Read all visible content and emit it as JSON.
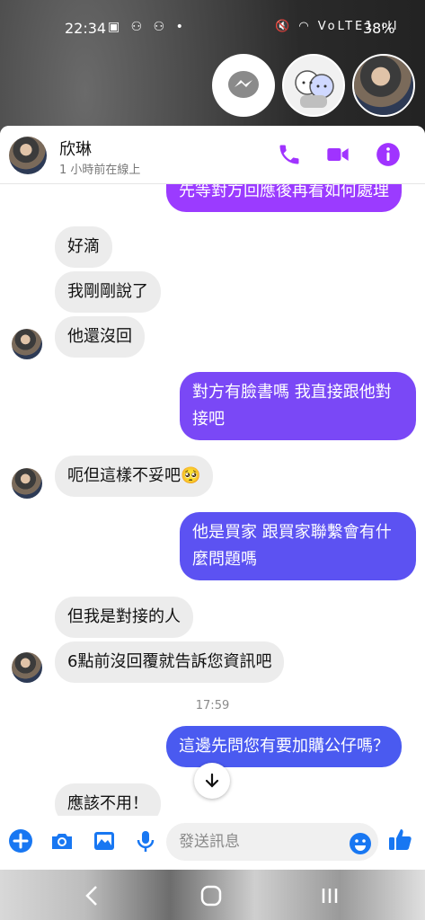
{
  "status_bar": {
    "time": "22:34",
    "left_icons": "▣ ⚇ ⚇ •",
    "right_icons": "🔇 ◠ VoLTE1 ıll",
    "battery": "38%"
  },
  "header": {
    "name": "欣琳",
    "status": "1 小時前在線上"
  },
  "messages": [
    {
      "dir": "out",
      "text": "先等對方回應後再看如何處理"
    },
    {
      "dir": "in",
      "text": "好滴"
    },
    {
      "dir": "in",
      "text": "我剛剛說了"
    },
    {
      "dir": "in",
      "text": "他還沒回"
    },
    {
      "dir": "out",
      "line1": "對方有臉書嗎 我直接跟他對",
      "line2": "接吧"
    },
    {
      "dir": "in",
      "text": "呃但這樣不妥吧🥺"
    },
    {
      "dir": "out",
      "line1": "他是買家 跟買家聯繫會有什",
      "line2": "麼問題嗎"
    },
    {
      "dir": "in",
      "text": "但我是對接的人"
    },
    {
      "dir": "in",
      "text": "6點前沒回覆就告訴您資訊吧"
    },
    {
      "dir": "out",
      "text": "這邊先問您有要加購公仔嗎？"
    },
    {
      "dir": "in",
      "text": "應該不用！"
    }
  ],
  "timestamp": "17:59",
  "composer": {
    "placeholder": "發送訊息"
  },
  "colors": {
    "accent": "#a033ff",
    "out_top": "#9b3bff",
    "out_bottom": "#4f56f0",
    "incoming": "#ececec"
  },
  "icons": {
    "header": [
      "phone-icon",
      "video-icon",
      "info-icon"
    ],
    "composer": [
      "plus-icon",
      "camera-icon",
      "image-icon",
      "mic-icon",
      "emoji-icon",
      "thumbs-up-icon"
    ],
    "nav": [
      "back-icon",
      "home-icon",
      "recents-icon"
    ]
  }
}
